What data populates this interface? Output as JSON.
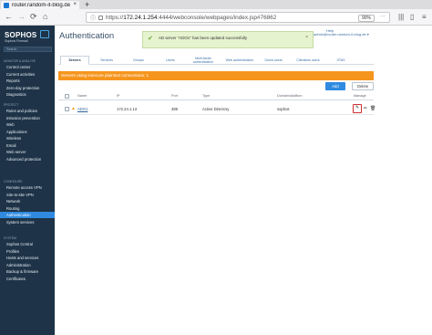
{
  "browser": {
    "tab_title": "router.random-it-blog.de",
    "close_glyph": "×",
    "newtab_glyph": "+",
    "back_glyph": "←",
    "forward_glyph": "→",
    "reload_glyph": "⟳",
    "home_glyph": "⌂",
    "url_prefix": "https://",
    "url_host": "172.24.1.254",
    "url_rest": ":4444/webconsole/webpages/index.jsp#76862",
    "zoom": "90%",
    "menu_dots": "···",
    "library_glyph": "|||",
    "sidebar_glyph": "▯",
    "hamburger_glyph": "≡"
  },
  "sidebar": {
    "brand": "SOPHOS",
    "brand_sub": "Sophos Firewall",
    "search_placeholder": "Search",
    "sections": [
      {
        "title": "Monitor & Analyze",
        "items": [
          "Control center",
          "Current activities",
          "Reports",
          "Zero-day protection",
          "Diagnostics"
        ]
      },
      {
        "title": "Protect",
        "items": [
          "Rules and policies",
          "Intrusion prevention",
          "Web",
          "Applications",
          "Wireless",
          "Email",
          "Web server",
          "Advanced protection"
        ]
      },
      {
        "title": "Configure",
        "items": [
          "Remote access VPN",
          "Site-to-site VPN",
          "Network",
          "Routing",
          "Authentication",
          "System services"
        ]
      },
      {
        "title": "System",
        "items": [
          "Sophos Central",
          "Profiles",
          "Hosts and services",
          "Administration",
          "Backup & firmware",
          "Certificates"
        ]
      }
    ],
    "active_item": "Authentication"
  },
  "header": {
    "title": "Authentication",
    "help": "Help",
    "user": "admin@router.random-it-blog.de ▾"
  },
  "toast": {
    "icon": "✔",
    "message": "AD server \"ADO1\" has been updated successfully",
    "close": "×"
  },
  "tabs": [
    "Servers",
    "Services",
    "Groups",
    "Users",
    "Multi-factor authentication",
    "Web authentication",
    "Guest users",
    "Clientless users",
    "STAS"
  ],
  "active_tab": "Servers",
  "warning": "Servers using insecure plaintext connections: 1",
  "buttons": {
    "add": "Add",
    "delete": "Delete"
  },
  "table": {
    "headers": {
      "name": "Name",
      "ip": "IP",
      "port": "Port",
      "type": "Type",
      "domain": "Domain/addition",
      "manage": "Manage"
    },
    "rows": [
      {
        "warn": "▲",
        "name": "ADO1",
        "ip": "172.24.1.13",
        "port": "389",
        "type": "Active Directory",
        "domain": "sophos",
        "edit": "✎",
        "pencil": "✏",
        "trash": "🗑"
      }
    ]
  }
}
